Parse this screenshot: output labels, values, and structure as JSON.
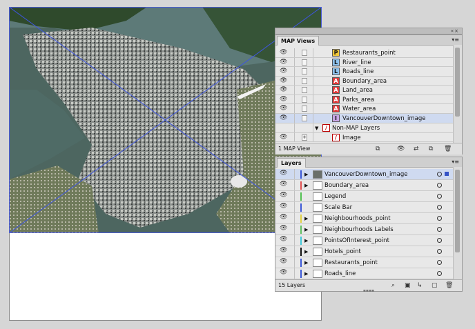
{
  "map_views_panel": {
    "tab": "MAP Views",
    "rows": [
      {
        "badge": "P",
        "badge_color": "#f2c83a",
        "label": "Restaurants_point"
      },
      {
        "badge": "L",
        "badge_color": "#8fc4ef",
        "label": "River_line"
      },
      {
        "badge": "L",
        "badge_color": "#8fc4ef",
        "label": "Roads_line"
      },
      {
        "badge": "A",
        "badge_color": "#e13a3a",
        "label": "Boundary_area"
      },
      {
        "badge": "A",
        "badge_color": "#e13a3a",
        "label": "Land_area"
      },
      {
        "badge": "A",
        "badge_color": "#e13a3a",
        "label": "Parks_area"
      },
      {
        "badge": "A",
        "badge_color": "#e13a3a",
        "label": "Water_area"
      },
      {
        "badge": "I",
        "badge_color": "#c9a6e6",
        "label": "VancouverDowntown_image"
      }
    ],
    "non_map_group": "Non-MAP Layers",
    "image_row": "Image",
    "footer": "1 MAP View"
  },
  "layers_panel": {
    "tab": "Layers",
    "rows": [
      {
        "label": "VancouverDowntown_image",
        "color": "#3b58d6"
      },
      {
        "label": "Boundary_area",
        "color": "#e05050"
      },
      {
        "label": "Legend",
        "color": "#50c050"
      },
      {
        "label": "Scale Bar",
        "color": "#3b58d6"
      },
      {
        "label": "Neighbourhoods_point",
        "color": "#e0d040"
      },
      {
        "label": "Neighbourhoods Labels",
        "color": "#60c060"
      },
      {
        "label": "PointsOfInterest_point",
        "color": "#40c8d8"
      },
      {
        "label": "Hotels_point",
        "color": "#111111"
      },
      {
        "label": "Restaurants_point",
        "color": "#3b58d6"
      },
      {
        "label": "Roads_line",
        "color": "#3b58d6"
      }
    ],
    "footer": "15 Layers"
  },
  "icons": {
    "visibility": "eye-icon",
    "panel_menu": "hamburger-icon",
    "collapse": "double-chevron-icon",
    "close": "close-icon"
  }
}
